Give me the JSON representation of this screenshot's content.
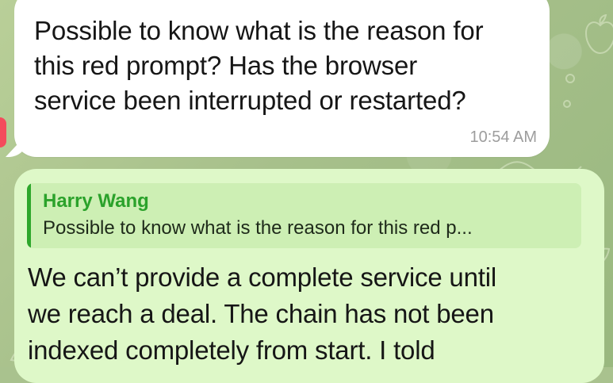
{
  "incoming_message": {
    "text": "Possible to know what is the reason for\nthis red prompt? Has the browser\nservice been interrupted or restarted?",
    "time": "10:54 AM"
  },
  "outgoing_message": {
    "reply": {
      "author": "Harry Wang",
      "snippet": "Possible to know what is the reason for this red p..."
    },
    "text": "We can’t provide a complete service until\nwe reach a deal. The chain has not been\nindexed completely from start. I told"
  },
  "colors": {
    "incoming_bubble": "#ffffff",
    "outgoing_bubble": "#def8c8",
    "reply_author": "#2ba22b",
    "background": "#a9c28e",
    "alert_accent": "#f44b5c"
  },
  "icons": {
    "background_doodles": "chat-wallpaper-doodles"
  }
}
